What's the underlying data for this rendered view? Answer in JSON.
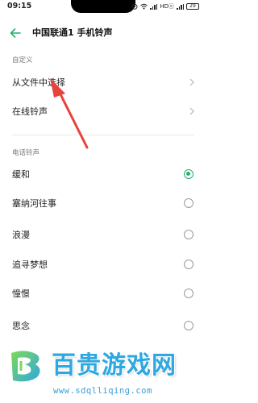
{
  "status_bar": {
    "time": "09:15",
    "indicators": "HDⓔ",
    "battery": "29"
  },
  "header": {
    "title": "中国联通1 手机铃声"
  },
  "custom_section": {
    "label": "自定义",
    "items": [
      {
        "label": "从文件中选择"
      },
      {
        "label": "在线铃声"
      }
    ]
  },
  "ringtone_section": {
    "label": "电话铃声",
    "selected_index": 0,
    "items": [
      {
        "label": "缓和"
      },
      {
        "label": "塞纳河往事"
      },
      {
        "label": "浪漫"
      },
      {
        "label": "追寻梦想"
      },
      {
        "label": "憧憬"
      },
      {
        "label": "思念"
      }
    ]
  },
  "watermark": {
    "title": "百贵游戏网",
    "url": "www.sdqlliqing.com"
  },
  "colors": {
    "accent": "#23b26d",
    "annotation_arrow": "#e8423d",
    "watermark_blue": "#2ea8e0"
  },
  "icons": {
    "back": "arrow-left-icon",
    "chevron": "chevron-right-icon",
    "radio_selected": "radio-checked-icon",
    "radio_unselected": "radio-empty-icon"
  }
}
